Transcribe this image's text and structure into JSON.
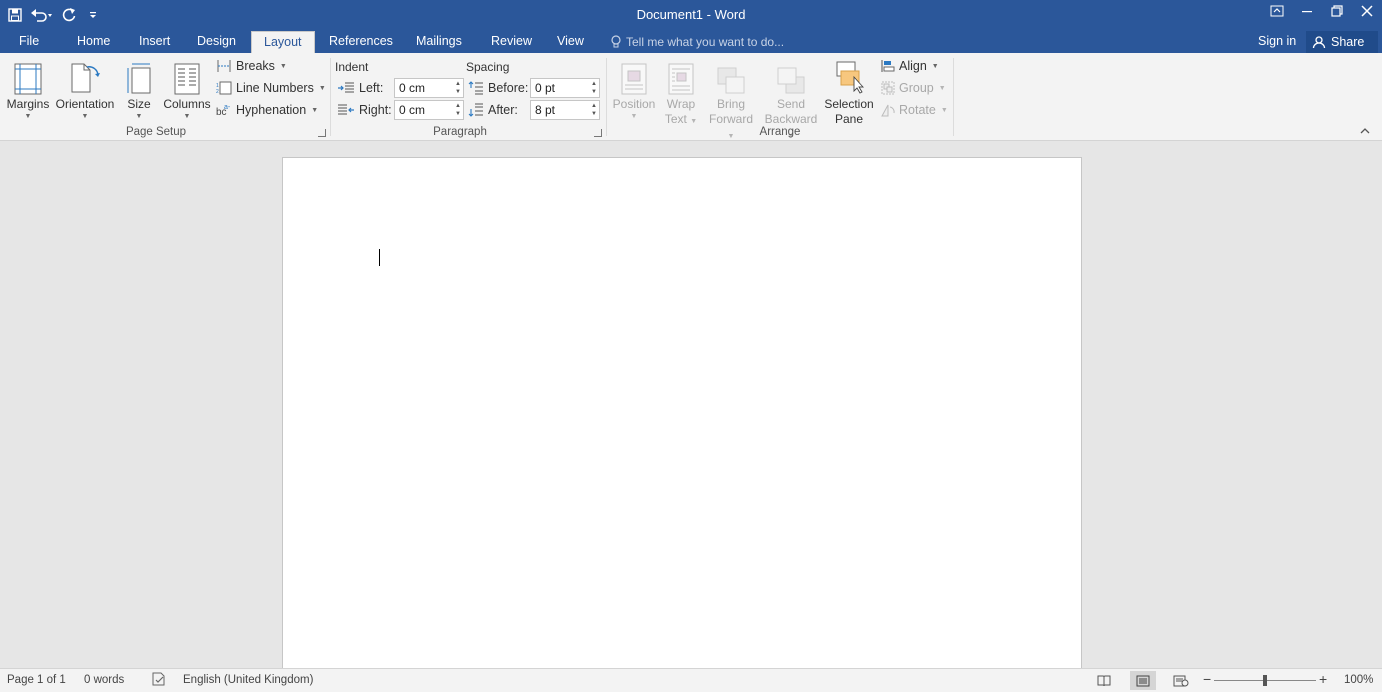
{
  "window": {
    "title": "Document1 - Word",
    "qat": {
      "save_icon": "save-icon",
      "undo_icon": "undo-icon",
      "redo_icon": "redo-icon",
      "customize_icon": "customize-qat-icon"
    },
    "controls": [
      "ribbon-display-options-icon",
      "minimize-icon",
      "restore-icon",
      "close-icon"
    ]
  },
  "tabs": [
    {
      "label": "File"
    },
    {
      "label": "Home"
    },
    {
      "label": "Insert"
    },
    {
      "label": "Design"
    },
    {
      "label": "Layout",
      "active": true
    },
    {
      "label": "References"
    },
    {
      "label": "Mailings"
    },
    {
      "label": "Review"
    },
    {
      "label": "View"
    }
  ],
  "tell_me": "Tell me what you want to do...",
  "signin": "Sign in",
  "share": "Share",
  "ribbon": {
    "page_setup": {
      "label": "Page Setup",
      "margins": "Margins",
      "orientation": "Orientation",
      "size": "Size",
      "columns": "Columns",
      "breaks": "Breaks",
      "line_numbers": "Line Numbers",
      "hyphenation": "Hyphenation"
    },
    "paragraph": {
      "label": "Paragraph",
      "indent_title": "Indent",
      "spacing_title": "Spacing",
      "left_label": "Left:",
      "left_value": "0 cm",
      "right_label": "Right:",
      "right_value": "0 cm",
      "before_label": "Before:",
      "before_value": "0 pt",
      "after_label": "After:",
      "after_value": "8 pt"
    },
    "arrange": {
      "label": "Arrange",
      "position_1": "Position",
      "wrap_1": "Wrap",
      "wrap_2": "Text",
      "bring_1": "Bring",
      "bring_2": "Forward",
      "send_1": "Send",
      "send_2": "Backward",
      "selection_1": "Selection",
      "selection_2": "Pane",
      "align": "Align",
      "group": "Group",
      "rotate": "Rotate"
    }
  },
  "status": {
    "page": "Page 1 of 1",
    "words": "0 words",
    "language": "English (United Kingdom)",
    "zoom": "100%",
    "zoom_level": 1.0,
    "active_view": "Print Layout"
  },
  "colors": {
    "accent": "#2b579a",
    "ribbon": "#f3f3f3",
    "canvas": "#e6e6e6"
  }
}
